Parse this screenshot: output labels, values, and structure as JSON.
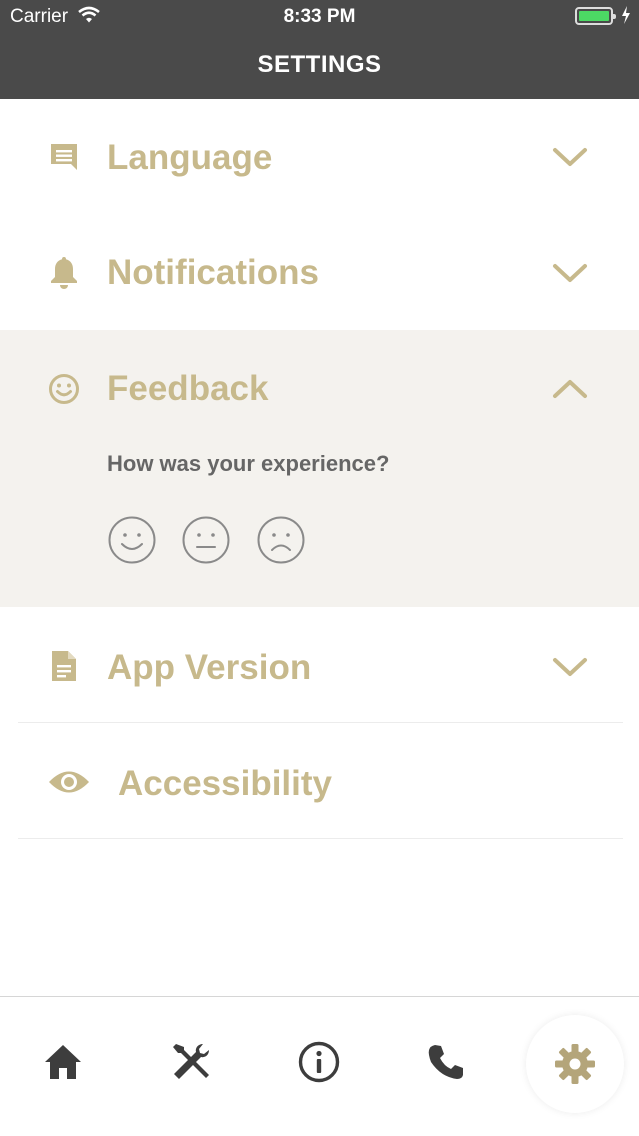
{
  "status_bar": {
    "carrier": "Carrier",
    "time": "8:33 PM"
  },
  "header": {
    "title": "SETTINGS"
  },
  "rows": [
    {
      "label": "Language",
      "icon": "chat-icon",
      "expanded": false
    },
    {
      "label": "Notifications",
      "icon": "bell-icon",
      "expanded": false
    },
    {
      "label": "Feedback",
      "icon": "smile-icon",
      "expanded": true
    },
    {
      "label": "App Version",
      "icon": "document-icon",
      "expanded": false
    },
    {
      "label": "Accessibility",
      "icon": "eye-icon",
      "expanded": false
    }
  ],
  "feedback": {
    "question": "How was your experience?",
    "options": [
      "happy-face-icon",
      "neutral-face-icon",
      "sad-face-icon"
    ]
  },
  "tabbar": {
    "items": [
      "home-icon",
      "tools-icon",
      "info-icon",
      "phone-icon",
      "settings-gear-icon"
    ],
    "active": "settings-gear-icon"
  },
  "colors": {
    "accent": "#c7b98c",
    "header_bg": "#4a4a4a",
    "expanded_bg": "#f4f2ee"
  }
}
